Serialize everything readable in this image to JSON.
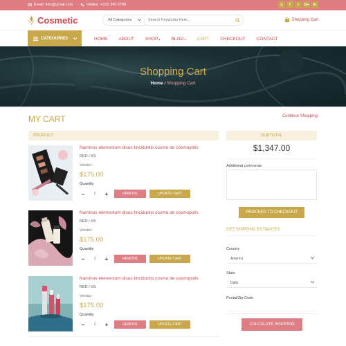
{
  "topbar": {
    "email": "Email: info@gmail.com",
    "hotline": "Hotline: +012 345 6789",
    "social": [
      "instagram-icon",
      "facebook-icon",
      "twitter-icon",
      "google-plus-icon",
      "linkedin-icon"
    ]
  },
  "header": {
    "logo": "Cosmetic",
    "search_category": "All Categories",
    "search_placeholder": "Search Keywords Here...",
    "cart_label": "Shopping Cart"
  },
  "nav": {
    "categories_label": "CATEGORIES",
    "items": [
      "HOME",
      "ABOUT",
      "SHOP",
      "BLOG",
      "CART",
      "CHECKOUT",
      "CONTACT"
    ],
    "active": "CART"
  },
  "banner": {
    "title": "Shopping Cart",
    "crumb_home": "Home",
    "crumb_sep": " / ",
    "crumb_current": "Shopping Cart"
  },
  "cart": {
    "title": "MY CART",
    "continue": "Continue Shopping",
    "product_header": "PRODUCT",
    "subtotal_header": "SUBTOTAL",
    "items": [
      {
        "name": "Naminos elementum disus tinciduntis cosmo de cosmopolis",
        "variant": "RED / XS",
        "vendor": "Vendor",
        "price": "$175.00",
        "qty_label": "Quantity",
        "qty": "1",
        "remove": "REMOVE",
        "update": "UPDATE CART"
      },
      {
        "name": "Naminos elementum disus tinciduntis cosmo de cosmopolis",
        "variant": "RED / XS",
        "vendor": "Vendor",
        "price": "$175.00",
        "qty_label": "Quantity",
        "qty": "1",
        "remove": "REMOVE",
        "update": "UPDATE CART"
      },
      {
        "name": "Naminos elementum disus tinciduntis cosmo de cosmopolis",
        "variant": "RED / XS",
        "vendor": "Vendor",
        "price": "$175.00",
        "qty_label": "Quantity",
        "qty": "1",
        "remove": "REMOVE",
        "update": "UPDATE CART"
      }
    ]
  },
  "summary": {
    "subtotal": "$1,347.00",
    "comments_label": "Additional comments",
    "checkout": "PROCEED TO CHECKOUT",
    "shipping_title": "GET SHIPPING ESTIMATES",
    "country_label": "Country",
    "country_value": "America",
    "state_label": "State",
    "state_value": "Dalls",
    "zip_label": "Postal/Zip Code",
    "calc": "CALCULATE SHIPPING"
  },
  "colors": {
    "accent_pink": "#de7e84",
    "accent_gold": "#c9a84c",
    "link_red": "#c9474e"
  }
}
